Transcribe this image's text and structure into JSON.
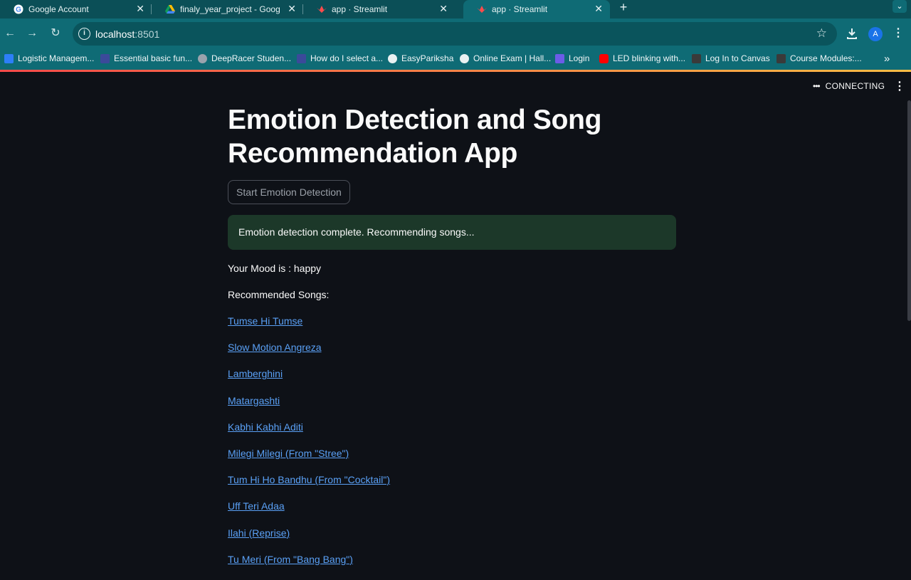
{
  "browser": {
    "tabs": [
      {
        "title": "Google Account",
        "icon": "google-icon",
        "active": false
      },
      {
        "title": "finaly_year_project - Google Drive",
        "icon": "google-drive-icon",
        "active": false
      },
      {
        "title": "app · Streamlit",
        "icon": "streamlit-icon",
        "active": false
      },
      {
        "title": "app · Streamlit",
        "icon": "streamlit-icon",
        "active": true
      }
    ],
    "url_host": "localhost",
    "url_port": ":8501",
    "profile_initial": "A",
    "bookmarks": [
      {
        "label": "Logistic Managem...",
        "color": "#2d7ff9"
      },
      {
        "label": "Essential basic fun...",
        "color": "#3b4a9a"
      },
      {
        "label": "DeepRacer Studen...",
        "color": "#9aa3ad"
      },
      {
        "label": "How do I select a...",
        "color": "#3b4a9a"
      },
      {
        "label": "EasyPariksha",
        "color": "#e9f1f2"
      },
      {
        "label": "Online Exam | Hall...",
        "color": "#e9f1f2"
      },
      {
        "label": "Login",
        "color": "#6c5ce7"
      },
      {
        "label": "LED blinking with...",
        "color": "#ff0000"
      },
      {
        "label": "Log In to Canvas",
        "color": "#3a3a3a"
      },
      {
        "label": "Course Modules:...",
        "color": "#3a3a3a"
      }
    ]
  },
  "app": {
    "status": "CONNECTING",
    "title": "Emotion Detection and Song Recommendation App",
    "start_button": "Start Emotion Detection",
    "success_message": "Emotion detection complete. Recommending songs...",
    "mood_text": "Your Mood is : happy",
    "recommended_heading": "Recommended Songs:",
    "songs": [
      "Tumse Hi Tumse",
      "Slow Motion Angreza",
      "Lamberghini",
      "Matargashti",
      "Kabhi Kabhi Aditi",
      "Milegi Milegi (From \"Stree\")",
      "Tum Hi Ho Bandhu (From \"Cocktail\")",
      "Uff Teri Adaa",
      "Ilahi (Reprise)",
      "Tu Meri (From \"Bang Bang\")"
    ]
  }
}
